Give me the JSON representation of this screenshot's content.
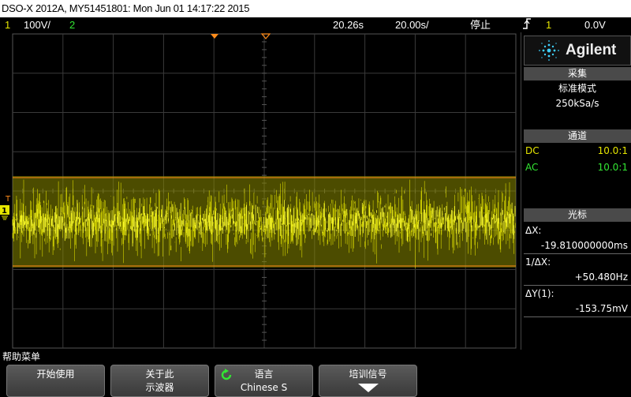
{
  "title_bar": "DSO-X 2012A, MY51451801: Mon Jun 01 14:17:22 2015",
  "status": {
    "ch1_number": "1",
    "ch1_scale": "100V/",
    "ch2_number": "2",
    "time_delay": "20.26s",
    "time_scale": "20.00s/",
    "run_state": "停止",
    "trigger_icon": "trigger-edge-icon",
    "trigger_source": "1",
    "trigger_level": "0.0V"
  },
  "colors": {
    "ch1": "#e6e600",
    "ch2": "#33e633",
    "marker": "#ff8c1a",
    "grid": "#3a3a3a"
  },
  "side_panel": {
    "brand": "Agilent",
    "acquire": {
      "header": "采集",
      "mode": "标准模式",
      "rate": "250kSa/s"
    },
    "channels": {
      "header": "通道",
      "rows": [
        {
          "coupling": "DC",
          "probe": "10.0:1"
        },
        {
          "coupling": "AC",
          "probe": "10.0:1"
        }
      ]
    },
    "cursors": {
      "header": "光标",
      "dx_label": "ΔX:",
      "dx_value": "-19.810000000ms",
      "inv_dx_label": "1/ΔX:",
      "inv_dx_value": "+50.480Hz",
      "dy_label": "ΔY(1):",
      "dy_value": "-153.75mV"
    }
  },
  "help_menu_label": "帮助菜单",
  "softkeys": [
    {
      "line1": "开始使用",
      "line2": ""
    },
    {
      "line1": "关于此",
      "line2": "示波器"
    },
    {
      "line1": "语言",
      "line2": "Chinese S",
      "icon": "rotate-knob-icon"
    },
    {
      "line1": "培训信号",
      "line2": "",
      "icon": "down-arrow-icon"
    }
  ],
  "screen_markers": {
    "trigger_label": "T",
    "ground_label": "1"
  }
}
